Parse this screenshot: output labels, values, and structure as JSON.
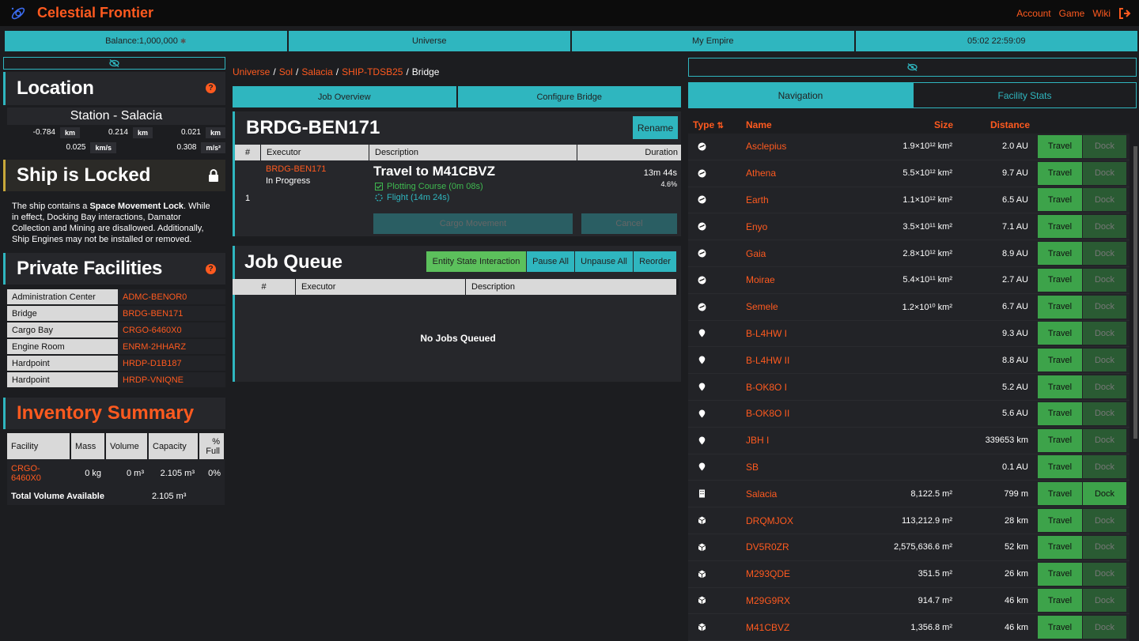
{
  "header": {
    "brand": "Celestial Frontier",
    "nav": [
      "Account",
      "Game",
      "Wiki"
    ]
  },
  "status": {
    "balance": "Balance:1,000,000",
    "universe": "Universe",
    "empire": "My Empire",
    "clock": "05:02 22:59:09"
  },
  "location": {
    "title": "Location",
    "station": "Station - Salacia",
    "coords": [
      "-0.784",
      "0.214",
      "0.021"
    ],
    "coord_unit": "km",
    "vel": [
      "0.025",
      "0.308"
    ],
    "vel_units": [
      "km/s",
      "m/s²"
    ]
  },
  "lock": {
    "title": "Ship is Locked",
    "text_a": "The ship contains a ",
    "text_b": "Space Movement Lock",
    "text_c": ". While in effect, Docking Bay interactions, Damator Collection and Mining are disallowed. Additionally, Ship Engines may not be installed or removed."
  },
  "facilities": {
    "title": "Private Facilities",
    "rows": [
      {
        "k": "Administration Center",
        "v": "ADMC-BENOR0"
      },
      {
        "k": "Bridge",
        "v": "BRDG-BEN171"
      },
      {
        "k": "Cargo Bay",
        "v": "CRGO-6460X0"
      },
      {
        "k": "Engine Room",
        "v": "ENRM-2HHARZ"
      },
      {
        "k": "Hardpoint",
        "v": "HRDP-D1B187"
      },
      {
        "k": "Hardpoint",
        "v": "HRDP-VNIQNE"
      }
    ]
  },
  "inventory": {
    "title": "Inventory Summary",
    "headers": [
      "Facility",
      "Mass",
      "Volume",
      "Capacity",
      "% Full"
    ],
    "row": [
      "CRGO-6460X0",
      "0 kg",
      "0 m³",
      "2.105 m³",
      "0%"
    ],
    "total_label": "Total Volume Available",
    "total_value": "2.105 m³"
  },
  "breadcrumb": [
    "Universe",
    "Sol",
    "Salacia",
    "SHIP-TDSB25",
    "Bridge"
  ],
  "bridge_tabs": [
    "Job Overview",
    "Configure Bridge"
  ],
  "bridge": {
    "title": "BRDG-BEN171",
    "rename": "Rename",
    "headers": [
      "#",
      "Executor",
      "Description",
      "Duration"
    ],
    "job_num": "1",
    "executor": "BRDG-BEN171",
    "state": "In Progress",
    "desc": "Travel to M41CBVZ",
    "step1": "Plotting Course (0m 08s)",
    "step2": "Flight (14m 24s)",
    "duration": "13m 44s",
    "pct": "4.6%",
    "cargo_btn": "Cargo Movement",
    "cancel_btn": "Cancel"
  },
  "queue": {
    "title": "Job Queue",
    "buttons": [
      "Entity State Interaction",
      "Pause All",
      "Unpause All",
      "Reorder"
    ],
    "headers": [
      "#",
      "Executor",
      "Description"
    ],
    "empty": "No Jobs Queued"
  },
  "nav_tabs": [
    "Navigation",
    "Facility Stats"
  ],
  "nav": {
    "headers": [
      "Type",
      "Name",
      "Size",
      "Distance"
    ],
    "travel": "Travel",
    "dock": "Dock",
    "rows": [
      {
        "type": "planet",
        "name": "Asclepius",
        "size": "1.9×10¹² km²",
        "dist": "2.0 AU",
        "dock": false
      },
      {
        "type": "planet",
        "name": "Athena",
        "size": "5.5×10¹² km²",
        "dist": "9.7 AU",
        "dock": false
      },
      {
        "type": "planet",
        "name": "Earth",
        "size": "1.1×10¹² km²",
        "dist": "6.5 AU",
        "dock": false
      },
      {
        "type": "planet",
        "name": "Enyo",
        "size": "3.5×10¹¹ km²",
        "dist": "7.1 AU",
        "dock": false
      },
      {
        "type": "planet",
        "name": "Gaia",
        "size": "2.8×10¹² km²",
        "dist": "8.9 AU",
        "dock": false
      },
      {
        "type": "planet",
        "name": "Moirae",
        "size": "5.4×10¹¹ km²",
        "dist": "2.7 AU",
        "dock": false
      },
      {
        "type": "planet",
        "name": "Semele",
        "size": "1.2×10¹⁰ km²",
        "dist": "6.7 AU",
        "dock": false
      },
      {
        "type": "pin",
        "name": "B-L4HW I",
        "size": "",
        "dist": "9.3 AU",
        "dock": false
      },
      {
        "type": "pin",
        "name": "B-L4HW II",
        "size": "",
        "dist": "8.8 AU",
        "dock": false
      },
      {
        "type": "pin",
        "name": "B-OK8O I",
        "size": "",
        "dist": "5.2 AU",
        "dock": false
      },
      {
        "type": "pin",
        "name": "B-OK8O II",
        "size": "",
        "dist": "5.6 AU",
        "dock": false
      },
      {
        "type": "pin",
        "name": "JBH I",
        "size": "",
        "dist": "339653 km",
        "dock": false
      },
      {
        "type": "pin",
        "name": "SB",
        "size": "",
        "dist": "0.1 AU",
        "dock": false
      },
      {
        "type": "building",
        "name": "Salacia",
        "size": "8,122.5 m²",
        "dist": "799 m",
        "dock": true
      },
      {
        "type": "cube",
        "name": "DRQMJOX",
        "size": "113,212.9 m²",
        "dist": "28 km",
        "dock": false
      },
      {
        "type": "cube",
        "name": "DV5R0ZR",
        "size": "2,575,636.6 m²",
        "dist": "52 km",
        "dock": false
      },
      {
        "type": "cube",
        "name": "M293QDE",
        "size": "351.5 m²",
        "dist": "26 km",
        "dock": false
      },
      {
        "type": "cube",
        "name": "M29G9RX",
        "size": "914.7 m²",
        "dist": "46 km",
        "dock": false
      },
      {
        "type": "cube",
        "name": "M41CBVZ",
        "size": "1,356.8 m²",
        "dist": "46 km",
        "dock": false
      }
    ]
  },
  "colors": {
    "accent": "#2fb6bf",
    "brand": "#ff5a1f",
    "go": "#3da34a"
  }
}
